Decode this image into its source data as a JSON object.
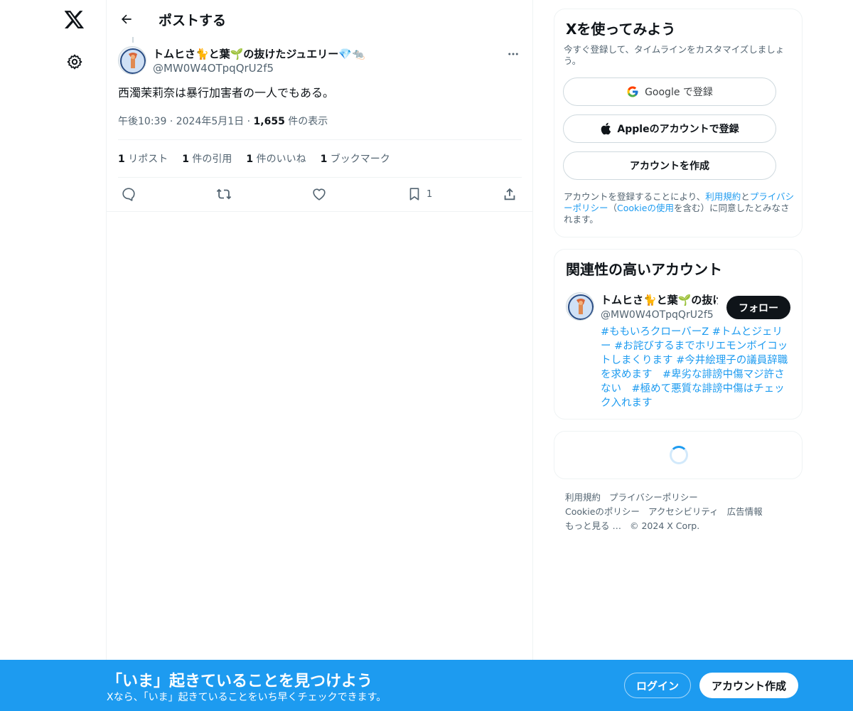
{
  "colors": {
    "accent": "#1d9bf0",
    "text": "#0f1419",
    "muted": "#536471",
    "border": "#eff3f4"
  },
  "nav": {
    "logo_icon": "x-logo-icon",
    "settings_icon": "gear-icon"
  },
  "header": {
    "title": "ポストする",
    "back_icon": "arrow-left-icon"
  },
  "tweet": {
    "author_name": "トムヒさ🐈と葉🌱の抜けたジュエリー💎🐀",
    "author_handle": "@MW0W4OTpqQrU2f5",
    "text": "西濁茉莉奈は暴行加害者の一人でもある。",
    "time": "午後10:39",
    "date": "2024年5月1日",
    "views_count": "1,655",
    "views_label": " 件の表示",
    "stats": {
      "reposts_count": "1",
      "reposts_label": " リポスト",
      "quotes_count": "1",
      "quotes_label": " 件の引用",
      "likes_count": "1",
      "likes_label": " 件のいいね",
      "bookmarks_count": "1",
      "bookmarks_label": " ブックマーク"
    },
    "bookmark_action_count": "1"
  },
  "signup": {
    "title": "Xを使ってみよう",
    "subtitle": "今すぐ登録して、タイムラインをカスタマイズしましょう。",
    "google_label": "Google で登録",
    "apple_label": "Appleのアカウントで登録",
    "create_label": "アカウントを作成",
    "terms_prefix": "アカウントを登録することにより、",
    "terms_link": "利用規約",
    "terms_and": "と",
    "privacy_link": "プライバシーポリシー",
    "terms_mid": "（",
    "cookie_link": "Cookieの使用",
    "terms_suffix": "を含む）に同意したとみなされます。"
  },
  "related": {
    "title": "関連性の高いアカウント",
    "name": "トムヒさ🐈と葉🌱の抜けたジュエリー💎🐀",
    "handle": "@MW0W4OTpqQrU2f5",
    "follow_label": "フォロー",
    "bio": "#ももいろクローバーZ #トムとジェリー #お詫びするまでホリエモンボイコットしまくります #今井絵理子の議員辞職を求めます　#卑劣な誹謗中傷マジ許さない　#極めて悪質な誹謗中傷はチェック入れます"
  },
  "footer": {
    "terms": "利用規約",
    "privacy": "プライバシーポリシー",
    "cookie": "Cookieのポリシー",
    "accessibility": "アクセシビリティ",
    "ads": "広告情報",
    "more": "もっと見る …",
    "copyright": "© 2024 X Corp."
  },
  "banner": {
    "title": "「いま」起きていることを見つけよう",
    "subtitle": "Xなら、「いま」起きていることをいち早くチェックできます。",
    "login_label": "ログイン",
    "signup_label": "アカウント作成"
  }
}
